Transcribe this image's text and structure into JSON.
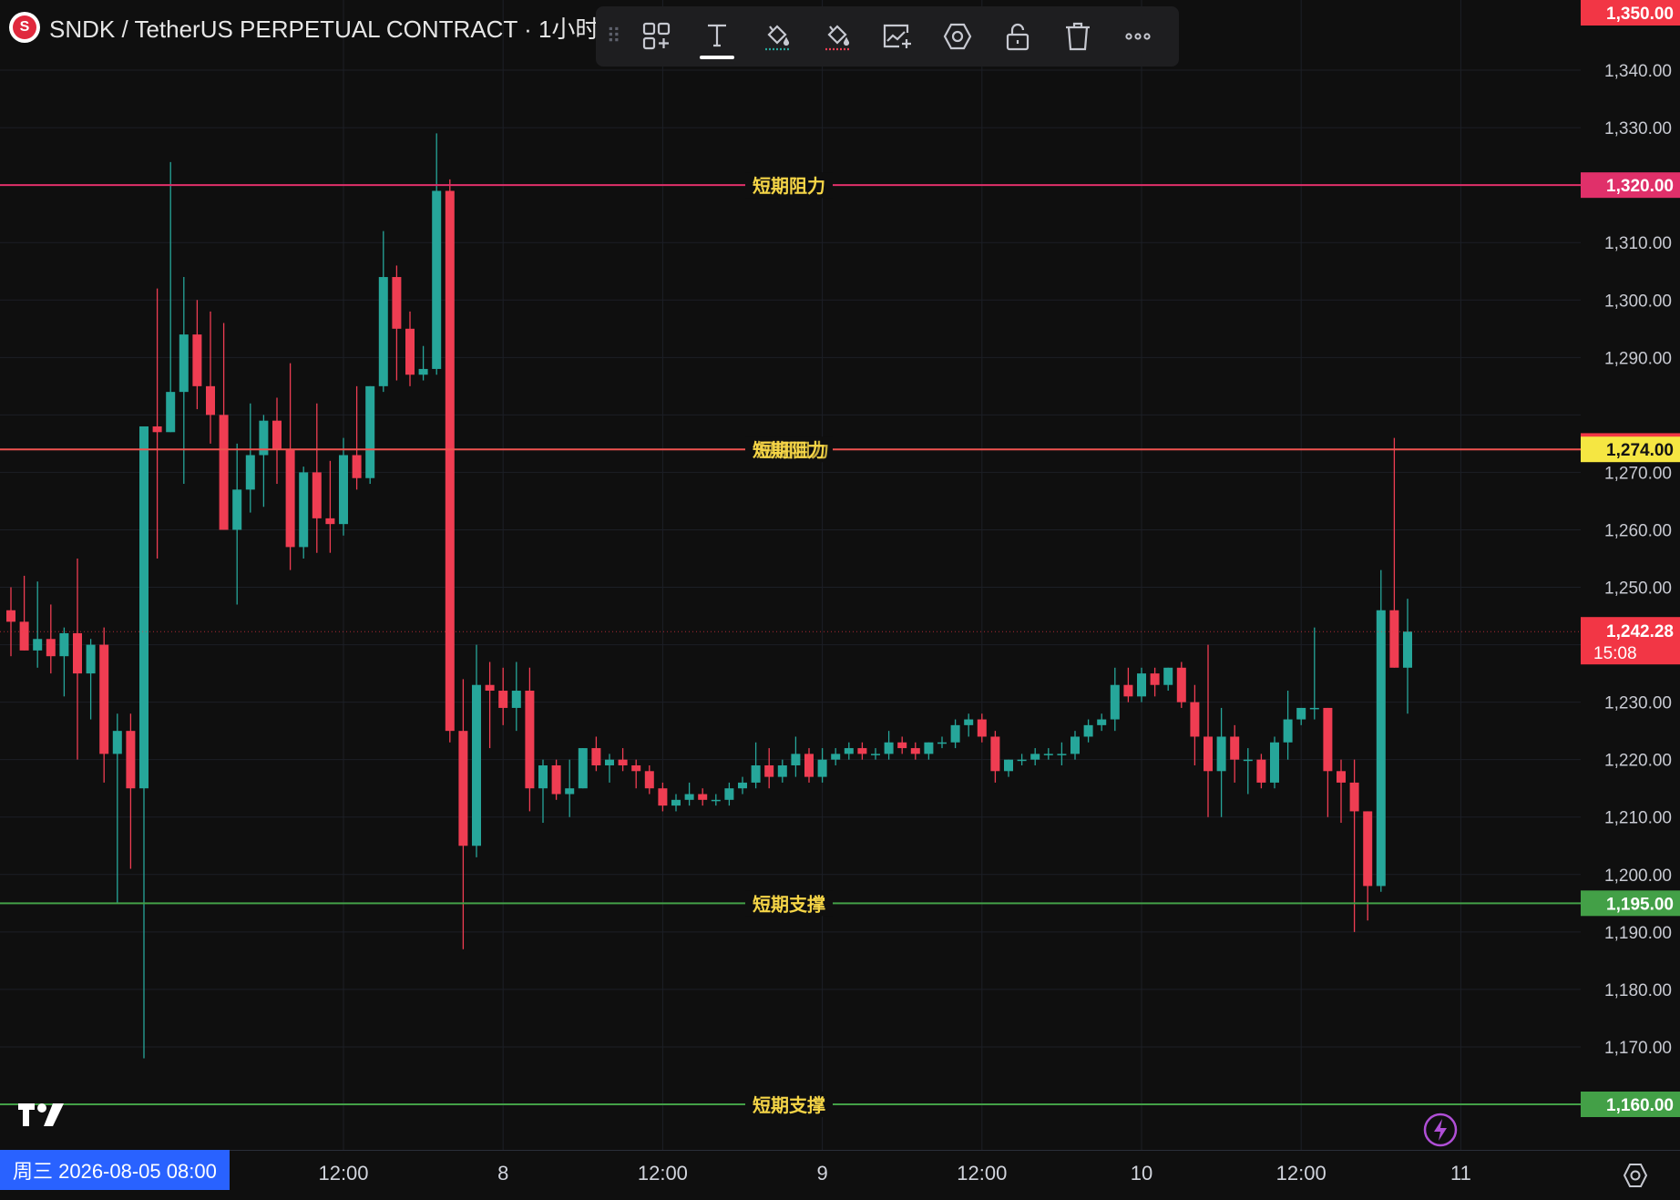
{
  "header": {
    "logo_letter": "S",
    "symbol_text": "SNDK / TetherUS PERPETUAL CONTRACT · 1小时"
  },
  "toolbar": {
    "icons": [
      "drag-grip-icon",
      "add-widget-icon",
      "text-icon",
      "fill-up-color-icon",
      "fill-down-color-icon",
      "add-chart-icon",
      "settings-hexagon-icon",
      "unlock-icon",
      "trash-icon",
      "more-icon"
    ]
  },
  "colors": {
    "up": "#26a69a",
    "down": "#ef3d52",
    "resistance": "#e0306a",
    "resistance2": "#ef5350",
    "support": "#43a047",
    "label_text": "#f5d547",
    "current": "#f23645",
    "highlight": "#f5e642",
    "date_chip": "#2962ff"
  },
  "chart_data": {
    "type": "candlestick",
    "title": "SNDK / TetherUS PERPETUAL CONTRACT · 1小时",
    "ylim": [
      1160,
      1350
    ],
    "y_ticks": [
      "1,340.00",
      "1,330.00",
      "1,310.00",
      "1,300.00",
      "1,290.00",
      "1,270.00",
      "1,260.00",
      "1,250.00",
      "1,230.00",
      "1,220.00",
      "1,210.00",
      "1,200.00",
      "1,190.00",
      "1,180.00",
      "1,170.00"
    ],
    "y_tick_values": [
      1340,
      1330,
      1310,
      1300,
      1290,
      1270,
      1260,
      1250,
      1230,
      1220,
      1210,
      1200,
      1190,
      1180,
      1170
    ],
    "x_ticks": [
      {
        "label": "12:00",
        "index": 25
      },
      {
        "label": "8",
        "index": 37
      },
      {
        "label": "12:00",
        "index": 49
      },
      {
        "label": "9",
        "index": 61
      },
      {
        "label": "12:00",
        "index": 73
      },
      {
        "label": "10",
        "index": 85
      },
      {
        "label": "12:00",
        "index": 97
      },
      {
        "label": "11",
        "index": 109
      }
    ],
    "date_chip": "周三 2026-08-05   08:00",
    "horizontal_lines": [
      {
        "name": "短期阻力",
        "price": 1320,
        "role": "resistance",
        "tag": "1,320.00"
      },
      {
        "name": "短期阻力",
        "price": 1274,
        "role": "resistance2",
        "tag": "1,274.00"
      },
      {
        "name": "短期支撑",
        "price": 1195,
        "role": "support",
        "tag": "1,195.00"
      },
      {
        "name": "短期支撑",
        "price": 1160,
        "role": "support",
        "tag": "1,160.00"
      }
    ],
    "overlap_label": "短期阻力",
    "price_tags": [
      {
        "text": "1,350.00",
        "price": 1350,
        "role": "current"
      },
      {
        "text": "1,274.00",
        "price": 1274.6,
        "role": "current"
      },
      {
        "text": "1,274.00",
        "price": 1274,
        "role": "highlight"
      }
    ],
    "last_price": {
      "price": 1242.28,
      "text": "1,242.28",
      "countdown": "15:08"
    },
    "candles": [
      {
        "o": 1246,
        "h": 1250,
        "l": 1238,
        "c": 1244
      },
      {
        "o": 1244,
        "h": 1252,
        "l": 1239,
        "c": 1239
      },
      {
        "o": 1239,
        "h": 1251,
        "l": 1236,
        "c": 1241
      },
      {
        "o": 1241,
        "h": 1247,
        "l": 1235,
        "c": 1238
      },
      {
        "o": 1238,
        "h": 1243,
        "l": 1231,
        "c": 1242
      },
      {
        "o": 1242,
        "h": 1255,
        "l": 1220,
        "c": 1235
      },
      {
        "o": 1235,
        "h": 1241,
        "l": 1227,
        "c": 1240
      },
      {
        "o": 1240,
        "h": 1243,
        "l": 1216,
        "c": 1221
      },
      {
        "o": 1221,
        "h": 1228,
        "l": 1195,
        "c": 1225
      },
      {
        "o": 1225,
        "h": 1228,
        "l": 1201,
        "c": 1215
      },
      {
        "o": 1215,
        "h": 1232,
        "l": 1168,
        "c": 1278
      },
      {
        "o": 1278,
        "h": 1302,
        "l": 1255,
        "c": 1277
      },
      {
        "o": 1277,
        "h": 1324,
        "l": 1277,
        "c": 1284
      },
      {
        "o": 1284,
        "h": 1304,
        "l": 1268,
        "c": 1294
      },
      {
        "o": 1294,
        "h": 1300,
        "l": 1281,
        "c": 1285
      },
      {
        "o": 1285,
        "h": 1298,
        "l": 1275,
        "c": 1280
      },
      {
        "o": 1280,
        "h": 1296,
        "l": 1260,
        "c": 1260
      },
      {
        "o": 1260,
        "h": 1275,
        "l": 1247,
        "c": 1267
      },
      {
        "o": 1267,
        "h": 1282,
        "l": 1263,
        "c": 1273
      },
      {
        "o": 1273,
        "h": 1280,
        "l": 1264,
        "c": 1279
      },
      {
        "o": 1279,
        "h": 1283,
        "l": 1268,
        "c": 1274
      },
      {
        "o": 1274,
        "h": 1289,
        "l": 1253,
        "c": 1257
      },
      {
        "o": 1257,
        "h": 1271,
        "l": 1255,
        "c": 1270
      },
      {
        "o": 1270,
        "h": 1282,
        "l": 1256,
        "c": 1262
      },
      {
        "o": 1262,
        "h": 1272,
        "l": 1256,
        "c": 1261
      },
      {
        "o": 1261,
        "h": 1276,
        "l": 1259,
        "c": 1273
      },
      {
        "o": 1273,
        "h": 1285,
        "l": 1267,
        "c": 1269
      },
      {
        "o": 1269,
        "h": 1285,
        "l": 1268,
        "c": 1285
      },
      {
        "o": 1285,
        "h": 1312,
        "l": 1284,
        "c": 1304
      },
      {
        "o": 1304,
        "h": 1306,
        "l": 1286,
        "c": 1295
      },
      {
        "o": 1295,
        "h": 1298,
        "l": 1285,
        "c": 1287
      },
      {
        "o": 1287,
        "h": 1292,
        "l": 1286,
        "c": 1288
      },
      {
        "o": 1288,
        "h": 1329,
        "l": 1287,
        "c": 1319
      },
      {
        "o": 1319,
        "h": 1321,
        "l": 1223,
        "c": 1225
      },
      {
        "o": 1225,
        "h": 1234,
        "l": 1187,
        "c": 1205
      },
      {
        "o": 1205,
        "h": 1240,
        "l": 1203,
        "c": 1233
      },
      {
        "o": 1233,
        "h": 1237,
        "l": 1222,
        "c": 1232
      },
      {
        "o": 1232,
        "h": 1236,
        "l": 1226,
        "c": 1229
      },
      {
        "o": 1229,
        "h": 1237,
        "l": 1225,
        "c": 1232
      },
      {
        "o": 1232,
        "h": 1236,
        "l": 1211,
        "c": 1215
      },
      {
        "o": 1215,
        "h": 1220,
        "l": 1209,
        "c": 1219
      },
      {
        "o": 1219,
        "h": 1220,
        "l": 1213,
        "c": 1214
      },
      {
        "o": 1214,
        "h": 1220,
        "l": 1210,
        "c": 1215
      },
      {
        "o": 1215,
        "h": 1222,
        "l": 1215,
        "c": 1222
      },
      {
        "o": 1222,
        "h": 1224,
        "l": 1218,
        "c": 1219
      },
      {
        "o": 1219,
        "h": 1221,
        "l": 1216,
        "c": 1220
      },
      {
        "o": 1220,
        "h": 1222,
        "l": 1218,
        "c": 1219
      },
      {
        "o": 1219,
        "h": 1220,
        "l": 1215,
        "c": 1218
      },
      {
        "o": 1218,
        "h": 1219,
        "l": 1214,
        "c": 1215
      },
      {
        "o": 1215,
        "h": 1216,
        "l": 1211,
        "c": 1212
      },
      {
        "o": 1212,
        "h": 1214,
        "l": 1211,
        "c": 1213
      },
      {
        "o": 1213,
        "h": 1216,
        "l": 1212,
        "c": 1214
      },
      {
        "o": 1214,
        "h": 1215,
        "l": 1212,
        "c": 1213
      },
      {
        "o": 1213,
        "h": 1214,
        "l": 1212,
        "c": 1213
      },
      {
        "o": 1213,
        "h": 1216,
        "l": 1212,
        "c": 1215
      },
      {
        "o": 1215,
        "h": 1217,
        "l": 1214,
        "c": 1216
      },
      {
        "o": 1216,
        "h": 1223,
        "l": 1215,
        "c": 1219
      },
      {
        "o": 1219,
        "h": 1222,
        "l": 1215,
        "c": 1217
      },
      {
        "o": 1217,
        "h": 1220,
        "l": 1216,
        "c": 1219
      },
      {
        "o": 1219,
        "h": 1224,
        "l": 1217,
        "c": 1221
      },
      {
        "o": 1221,
        "h": 1222,
        "l": 1216,
        "c": 1217
      },
      {
        "o": 1217,
        "h": 1222,
        "l": 1216,
        "c": 1220
      },
      {
        "o": 1220,
        "h": 1222,
        "l": 1219,
        "c": 1221
      },
      {
        "o": 1221,
        "h": 1223,
        "l": 1220,
        "c": 1222
      },
      {
        "o": 1222,
        "h": 1223,
        "l": 1220,
        "c": 1221
      },
      {
        "o": 1221,
        "h": 1222,
        "l": 1220,
        "c": 1221
      },
      {
        "o": 1221,
        "h": 1225,
        "l": 1220,
        "c": 1223
      },
      {
        "o": 1223,
        "h": 1224,
        "l": 1221,
        "c": 1222
      },
      {
        "o": 1222,
        "h": 1223,
        "l": 1220,
        "c": 1221
      },
      {
        "o": 1221,
        "h": 1223,
        "l": 1220,
        "c": 1223
      },
      {
        "o": 1223,
        "h": 1224,
        "l": 1222,
        "c": 1223
      },
      {
        "o": 1223,
        "h": 1227,
        "l": 1222,
        "c": 1226
      },
      {
        "o": 1226,
        "h": 1228,
        "l": 1224,
        "c": 1227
      },
      {
        "o": 1227,
        "h": 1228,
        "l": 1223,
        "c": 1224
      },
      {
        "o": 1224,
        "h": 1225,
        "l": 1216,
        "c": 1218
      },
      {
        "o": 1218,
        "h": 1220,
        "l": 1217,
        "c": 1220
      },
      {
        "o": 1220,
        "h": 1221,
        "l": 1219,
        "c": 1220
      },
      {
        "o": 1220,
        "h": 1222,
        "l": 1219,
        "c": 1221
      },
      {
        "o": 1221,
        "h": 1222,
        "l": 1220,
        "c": 1221
      },
      {
        "o": 1221,
        "h": 1223,
        "l": 1219,
        "c": 1221
      },
      {
        "o": 1221,
        "h": 1225,
        "l": 1220,
        "c": 1224
      },
      {
        "o": 1224,
        "h": 1227,
        "l": 1223,
        "c": 1226
      },
      {
        "o": 1226,
        "h": 1228,
        "l": 1225,
        "c": 1227
      },
      {
        "o": 1227,
        "h": 1236,
        "l": 1225,
        "c": 1233
      },
      {
        "o": 1233,
        "h": 1236,
        "l": 1230,
        "c": 1231
      },
      {
        "o": 1231,
        "h": 1236,
        "l": 1230,
        "c": 1235
      },
      {
        "o": 1235,
        "h": 1236,
        "l": 1231,
        "c": 1233
      },
      {
        "o": 1233,
        "h": 1236,
        "l": 1232,
        "c": 1236
      },
      {
        "o": 1236,
        "h": 1237,
        "l": 1229,
        "c": 1230
      },
      {
        "o": 1230,
        "h": 1233,
        "l": 1219,
        "c": 1224
      },
      {
        "o": 1224,
        "h": 1240,
        "l": 1210,
        "c": 1218
      },
      {
        "o": 1218,
        "h": 1229,
        "l": 1210,
        "c": 1224
      },
      {
        "o": 1224,
        "h": 1226,
        "l": 1216,
        "c": 1220
      },
      {
        "o": 1220,
        "h": 1222,
        "l": 1214,
        "c": 1220
      },
      {
        "o": 1220,
        "h": 1221,
        "l": 1215,
        "c": 1216
      },
      {
        "o": 1216,
        "h": 1224,
        "l": 1215,
        "c": 1223
      },
      {
        "o": 1223,
        "h": 1232,
        "l": 1220,
        "c": 1227
      },
      {
        "o": 1227,
        "h": 1229,
        "l": 1226,
        "c": 1229
      },
      {
        "o": 1229,
        "h": 1243,
        "l": 1227,
        "c": 1229
      },
      {
        "o": 1229,
        "h": 1229,
        "l": 1210,
        "c": 1218
      },
      {
        "o": 1218,
        "h": 1220,
        "l": 1209,
        "c": 1216
      },
      {
        "o": 1216,
        "h": 1220,
        "l": 1190,
        "c": 1211
      },
      {
        "o": 1211,
        "h": 1211,
        "l": 1192,
        "c": 1198
      },
      {
        "o": 1198,
        "h": 1253,
        "l": 1197,
        "c": 1246
      },
      {
        "o": 1246,
        "h": 1276,
        "l": 1236,
        "c": 1236
      },
      {
        "o": 1236,
        "h": 1248,
        "l": 1228,
        "c": 1242.28
      }
    ]
  }
}
